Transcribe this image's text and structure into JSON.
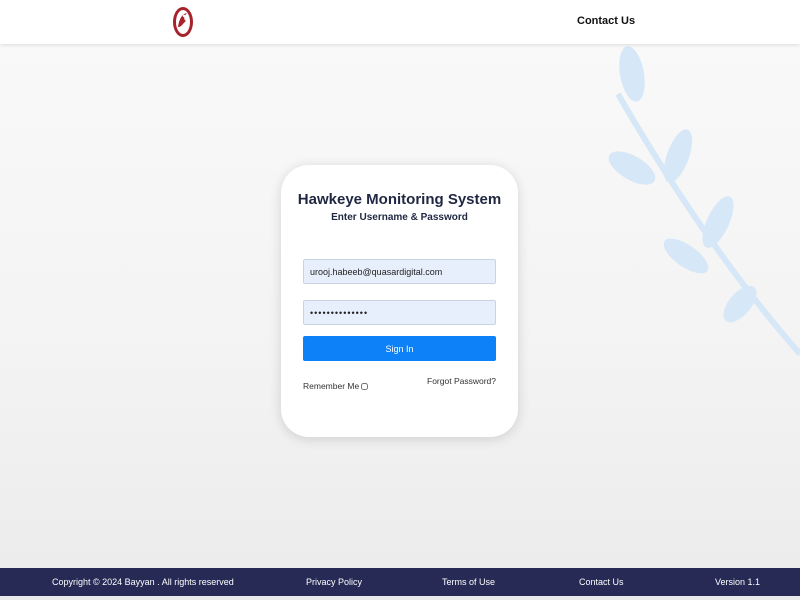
{
  "header": {
    "logo_icon": "eagle-logo-icon",
    "contact_label": "Contact Us"
  },
  "login": {
    "title": "Hawkeye Monitoring System",
    "subtitle": "Enter Username & Password",
    "email_value": "urooj.habeeb@quasardigital.com",
    "password_value": "••••••••••••••",
    "signin_label": "Sign In",
    "remember_label": "Remember Me",
    "forgot_label": "Forgot Password?"
  },
  "footer": {
    "copyright": "Copyright © 2024 Bayyan . All rights reserved",
    "privacy": "Privacy Policy",
    "terms": "Terms of Use",
    "contact": "Contact Us",
    "version": "Version 1.1"
  },
  "colors": {
    "primary_button": "#0d82f8",
    "footer_bg": "#262a55",
    "title_text": "#1f2742",
    "logo_red": "#a7232b"
  }
}
